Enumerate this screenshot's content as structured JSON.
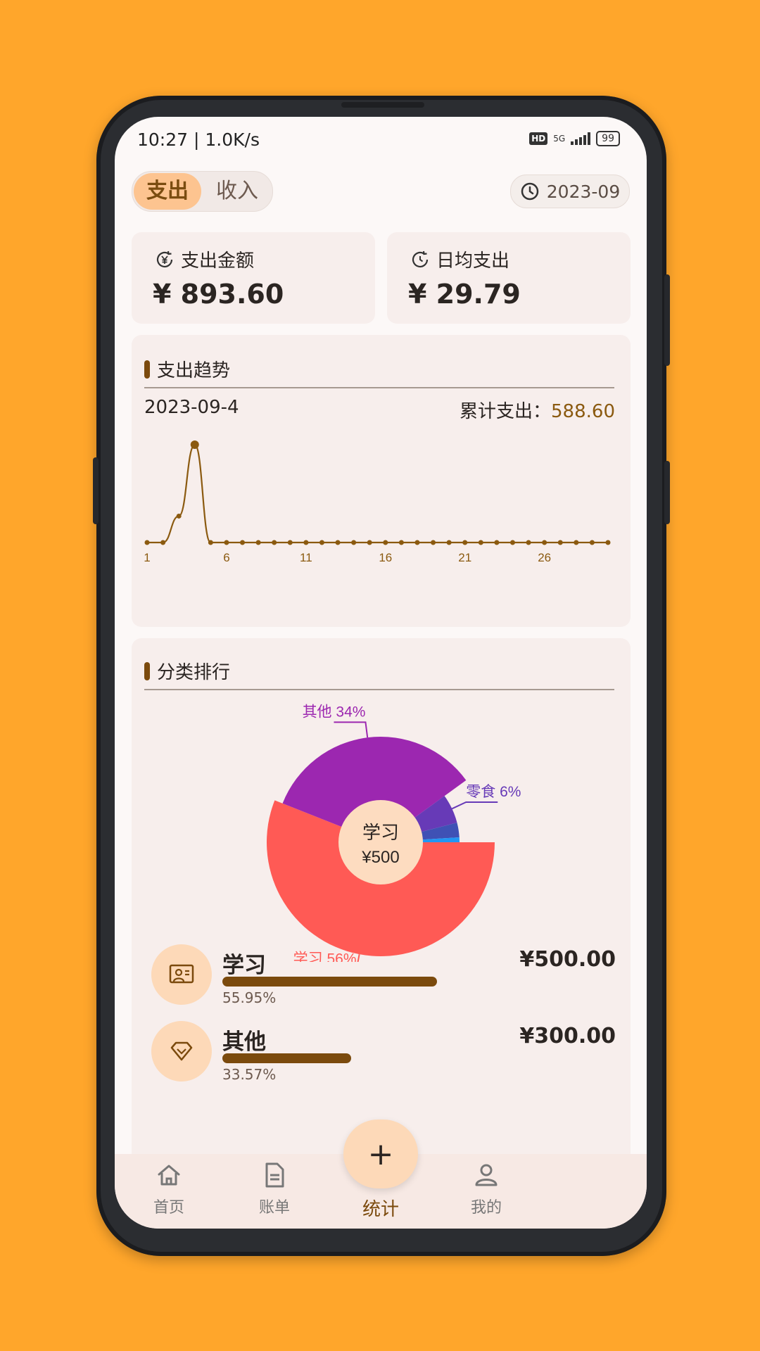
{
  "status": {
    "time": "10:27 | 1.0K/s",
    "hd": "HD",
    "network": "5G",
    "battery": "99"
  },
  "tabs_toggle": {
    "expense": "支出",
    "income": "收入"
  },
  "month": "2023-09",
  "summary": {
    "total_label": "支出金额",
    "total_value": "¥ 893.60",
    "daily_label": "日均支出",
    "daily_value": "¥ 29.79"
  },
  "trend": {
    "title": "支出趋势",
    "selected_date": "2023-09-4",
    "total_label": "累计支出：",
    "total_value": "588.60"
  },
  "chart_data": [
    {
      "type": "line",
      "x": [
        1,
        2,
        3,
        4,
        5,
        6,
        7,
        8,
        9,
        10,
        11,
        12,
        13,
        14,
        15,
        16,
        17,
        18,
        19,
        20,
        21,
        22,
        23,
        24,
        25,
        26,
        27,
        28,
        29,
        30
      ],
      "tick_labels": [
        "1",
        "6",
        "11",
        "16",
        "21",
        "26"
      ],
      "values": [
        0,
        0,
        159,
        588.6,
        0,
        0,
        0,
        0,
        0,
        0,
        0,
        0,
        0,
        0,
        0,
        0,
        0,
        0,
        0,
        0,
        0,
        0,
        0,
        0,
        0,
        0,
        0,
        0,
        0,
        0
      ],
      "highlight_index": 3,
      "color": "#8b5a10"
    },
    {
      "type": "pie",
      "title": "分类排行",
      "center_label": "学习",
      "center_value": "¥500",
      "slices": [
        {
          "name": "学习",
          "percent": 56,
          "label": "学习 56%",
          "color": "#FF5A55"
        },
        {
          "name": "其他",
          "percent": 34,
          "label": "其他 34%",
          "color": "#9C27B0"
        },
        {
          "name": "零食",
          "percent": 6,
          "label": "零食 6%",
          "color": "#673AB7"
        },
        {
          "name": "",
          "percent": 3,
          "label": "",
          "color": "#3F51B5"
        },
        {
          "name": "",
          "percent": 1,
          "label": "",
          "color": "#2196F3"
        }
      ]
    }
  ],
  "ranking": [
    {
      "name": "学习",
      "amount": "¥500.00",
      "percent_text": "55.95%",
      "ratio": 0.5595,
      "icon": "study-board-icon"
    },
    {
      "name": "其他",
      "amount": "¥300.00",
      "percent_text": "33.57%",
      "ratio": 0.3357,
      "icon": "diamond-icon"
    }
  ],
  "nav": {
    "home": "首页",
    "bills": "账单",
    "stats": "统计",
    "mine": "我的",
    "add": "+"
  },
  "colors": {
    "accent": "#7b4a0d",
    "background": "#FFA62B",
    "card": "#f7eeec"
  }
}
